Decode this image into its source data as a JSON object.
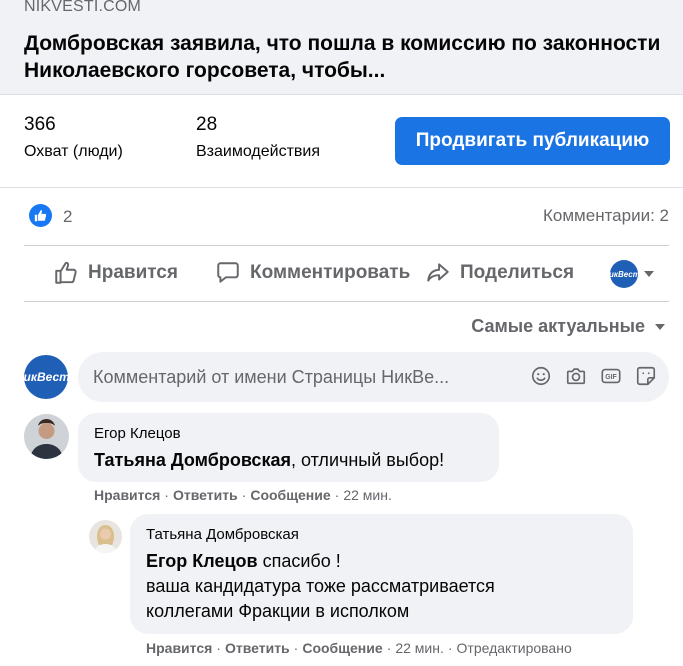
{
  "link": {
    "domain": "NIKVESTI.COM",
    "title": "Домбровская заявила, что пошла в комиссию по законности Николаевского горсовета, чтобы..."
  },
  "insights": {
    "reach_value": "366",
    "reach_label": "Охват (люди)",
    "engagement_value": "28",
    "engagement_label": "Взаимодействия",
    "boost_label": "Продвигать публикацию"
  },
  "reactions": {
    "count": "2",
    "comments": "Комментарии: 2"
  },
  "actions": {
    "like": "Нравится",
    "comment": "Комментировать",
    "share": "Поделиться"
  },
  "page": {
    "avatar_text": "НикВести",
    "avatar_color": "#1f5fb5"
  },
  "sort": {
    "label": "Самые актуальные"
  },
  "composer": {
    "placeholder": "Комментарий от имени Страницы НикВе..."
  },
  "comments": [
    {
      "author": "Егор Клецов",
      "mention": "Татьяна Домбровская",
      "text": ", отличный выбор!",
      "like": "Нравится",
      "reply": "Ответить",
      "message": "Сообщение",
      "time": "22 мин."
    },
    {
      "author": "Татьяна Домбровская",
      "mention": "Егор Клецов",
      "text_line1": " спасибо !",
      "text_line2": "ваша кандидатура тоже рассматривается",
      "text_line3": "коллегами Фракции в исполком",
      "like": "Нравится",
      "reply": "Ответить",
      "message": "Сообщение",
      "time": "22 мин.",
      "edited": "Отредактировано"
    }
  ],
  "colors": {
    "accent": "#1b74e4",
    "secondary_text": "#65676b",
    "bubble": "#f0f2f5"
  }
}
